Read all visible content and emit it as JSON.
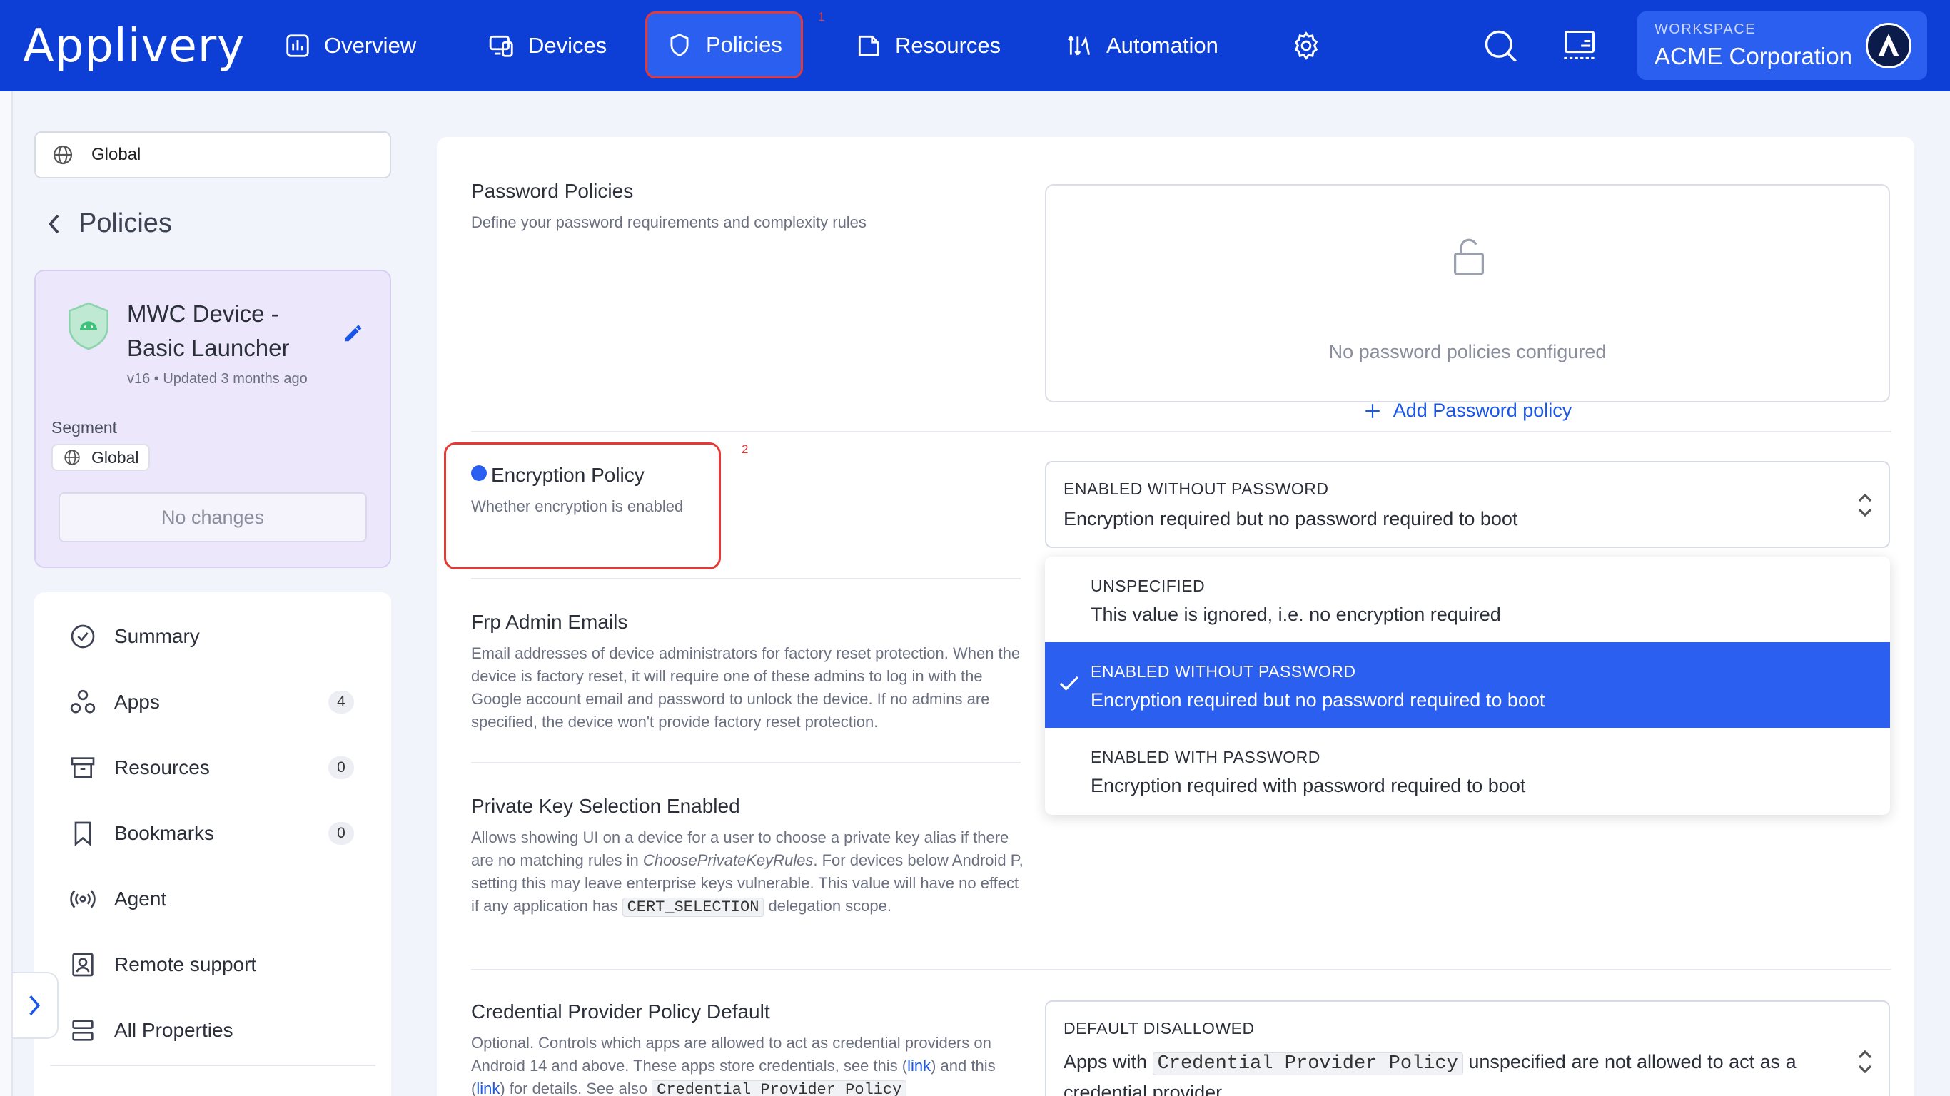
{
  "topbar": {
    "logo": "Applivery",
    "nav": [
      {
        "label": "Overview",
        "icon": "chart-bars-icon"
      },
      {
        "label": "Devices",
        "icon": "devices-icon"
      },
      {
        "label": "Policies",
        "icon": "shield-icon"
      },
      {
        "label": "Resources",
        "icon": "folder-icon"
      },
      {
        "label": "Automation",
        "icon": "automation-icon"
      }
    ],
    "active_nav": "Policies",
    "step_markers": [
      "1",
      "2"
    ],
    "workspace_label": "WORKSPACE",
    "workspace_name": "ACME Corporation"
  },
  "sidebar": {
    "scope": "Global",
    "back_title": "Policies",
    "policy": {
      "name": "MWC Device - Basic Launcher",
      "meta": "v16 • Updated 3 months ago",
      "segment_label": "Segment",
      "segment_value": "Global",
      "status_button": "No changes"
    },
    "menu": [
      {
        "label": "Summary",
        "icon": "check-circle-icon",
        "count": null
      },
      {
        "label": "Apps",
        "icon": "apps-icon",
        "count": "4"
      },
      {
        "label": "Resources",
        "icon": "archive-icon",
        "count": "0"
      },
      {
        "label": "Bookmarks",
        "icon": "bookmark-icon",
        "count": "0"
      },
      {
        "label": "Agent",
        "icon": "broadcast-icon",
        "count": null
      },
      {
        "label": "Remote support",
        "icon": "remote-support-icon",
        "count": null
      },
      {
        "label": "All Properties",
        "icon": "list-icon",
        "count": null
      }
    ]
  },
  "main": {
    "password": {
      "title": "Password Policies",
      "desc": "Define your password requirements and complexity rules",
      "empty_text": "No password policies configured",
      "add_label": "Add Password policy"
    },
    "encryption": {
      "title": "Encryption Policy",
      "desc": "Whether encryption is enabled",
      "selected_label": "ENABLED WITHOUT PASSWORD",
      "selected_desc": "Encryption required but no password required to boot",
      "options": [
        {
          "label": "UNSPECIFIED",
          "desc": "This value is ignored, i.e. no encryption required",
          "selected": false
        },
        {
          "label": "ENABLED WITHOUT PASSWORD",
          "desc": "Encryption required but no password required to boot",
          "selected": true
        },
        {
          "label": "ENABLED WITH PASSWORD",
          "desc": "Encryption required with password required to boot",
          "selected": false
        }
      ]
    },
    "frp": {
      "title": "Frp Admin Emails",
      "desc": "Email addresses of device administrators for factory reset protection. When the device is factory reset, it will require one of these admins to log in with the Google account email and password to unlock the device. If no admins are specified, the device won't provide factory reset protection."
    },
    "private_key": {
      "title": "Private Key Selection Enabled",
      "desc_1": "Allows showing UI on a device for a user to choose a private key alias if there are no matching rules in ",
      "desc_em": "ChoosePrivateKeyRules",
      "desc_2": ". For devices below Android P, setting this may leave enterprise keys vulnerable. This value will have no effect if any application has ",
      "desc_code": "CERT_SELECTION",
      "desc_3": " delegation scope."
    },
    "credential": {
      "title": "Credential Provider Policy Default",
      "desc_1": "Optional. Controls which apps are allowed to act as credential providers on Android 14 and above. These apps store credentials, see this (",
      "link_1": "link",
      "desc_2": ") and this (",
      "link_2": "link",
      "desc_3": ") for details. See also ",
      "desc_code": "Credential Provider Policy",
      "selected_label": "DEFAULT DISALLOWED",
      "sel_desc_1": "Apps with ",
      "sel_code": "Credential Provider Policy",
      "sel_desc_2": " unspecified are not allowed to act as a credential provider."
    }
  },
  "colors": {
    "brand": "#0d3fd6",
    "accent": "#2a5ff0",
    "highlight": "#e53935",
    "link": "#1a56e8"
  }
}
